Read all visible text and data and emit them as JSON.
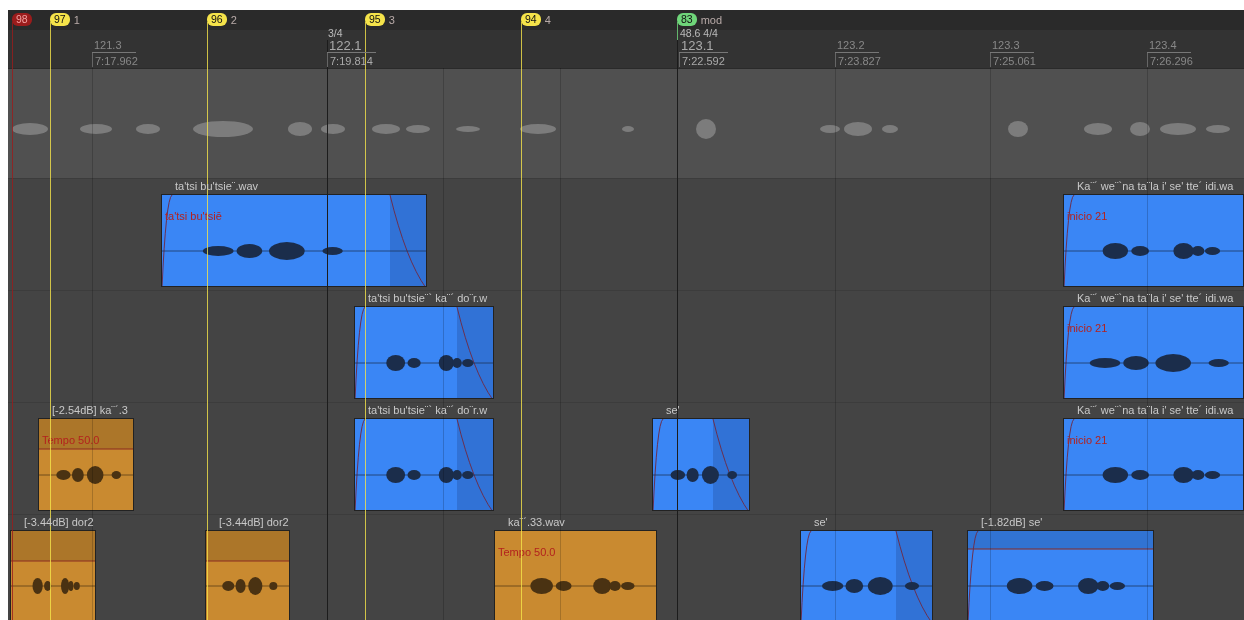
{
  "markers": [
    {
      "number": "98",
      "color": "#9b1c1c"
    },
    {
      "number": "97",
      "label": "1",
      "color": "#f5e34a"
    },
    {
      "number": "96",
      "label": "2",
      "color": "#f5e34a"
    },
    {
      "number": "95",
      "label": "3",
      "color": "#f5e34a"
    },
    {
      "number": "94",
      "label": "4",
      "color": "#f5e34a"
    },
    {
      "number": "83",
      "label": "mod",
      "color": "#6fd67a"
    }
  ],
  "ruler": [
    {
      "bar": "121.3",
      "time": "7:17.962",
      "major": false
    },
    {
      "signature": "3/4",
      "bar": "122.1",
      "time": "7:19.814",
      "major": true
    },
    {
      "signature": "48.6 4/4",
      "bar": "123.1",
      "time": "7:22.592",
      "major": true
    },
    {
      "bar": "123.2",
      "time": "7:23.827",
      "major": false
    },
    {
      "bar": "123.3",
      "time": "7:25.061",
      "major": false
    },
    {
      "bar": "123.4",
      "time": "7:26.296",
      "major": false
    }
  ],
  "tracks": [
    {
      "kind": "reference"
    },
    {
      "kind": "audio",
      "clips": [
        {
          "title": "ta'tsi bu'tsie¨.wav",
          "label": "ta'tsi bu'tsiē",
          "color": "#3a86f5",
          "fade_out": true,
          "gain_envelope": false
        },
        {
          "title": "Ka¨´ we¨`na ta¨la i' se' tte´ idi.wa",
          "label": "inicio 21",
          "color": "#3a86f5",
          "fade_out": false,
          "gain_envelope": false
        }
      ]
    },
    {
      "kind": "audio",
      "clips": [
        {
          "title": "ta'tsi bu'tsie¨` ka¨´ do¨r.w",
          "color": "#3a86f5",
          "fade_out": true,
          "gain_envelope": false
        },
        {
          "title": "Ka¨´ we¨`na ta¨la i' se' tte´ idi.wa",
          "label": "inicio 21",
          "color": "#3a86f5",
          "fade_out": false,
          "gain_envelope": false
        }
      ]
    },
    {
      "kind": "audio",
      "clips": [
        {
          "title": "[-2.54dB] ka¨´.3",
          "label": "Tempo 50.0",
          "color": "#c98a30",
          "fade_out": false,
          "gain_envelope": true
        },
        {
          "title": "ta'tsi bu'tsie¨` ka¨´ do¨r.w",
          "color": "#3a86f5",
          "fade_out": true,
          "gain_envelope": false
        },
        {
          "title": "se'",
          "color": "#3a86f5",
          "fade_out": true,
          "gain_envelope": false
        },
        {
          "title": "Ka¨´ we¨`na ta¨la i' se' tte´ idi.wa",
          "label": "inicio 21",
          "color": "#3a86f5",
          "fade_out": false,
          "gain_envelope": false
        }
      ]
    },
    {
      "kind": "audio",
      "clips": [
        {
          "title": "[-3.44dB] dor2",
          "color": "#c98a30",
          "fade_out": false,
          "gain_envelope": true
        },
        {
          "title": "[-3.44dB] dor2",
          "color": "#c98a30",
          "fade_out": false,
          "gain_envelope": true
        },
        {
          "title": "ka¨´.33.wav",
          "label": "Tempo 50.0",
          "color": "#c98a30",
          "fade_out": false,
          "gain_envelope": false
        },
        {
          "title": "se'",
          "color": "#3a86f5",
          "fade_out": true,
          "gain_envelope": false
        },
        {
          "title": "[-1.82dB] se'",
          "color": "#3a86f5",
          "fade_out": false,
          "gain_envelope": true
        }
      ]
    }
  ]
}
